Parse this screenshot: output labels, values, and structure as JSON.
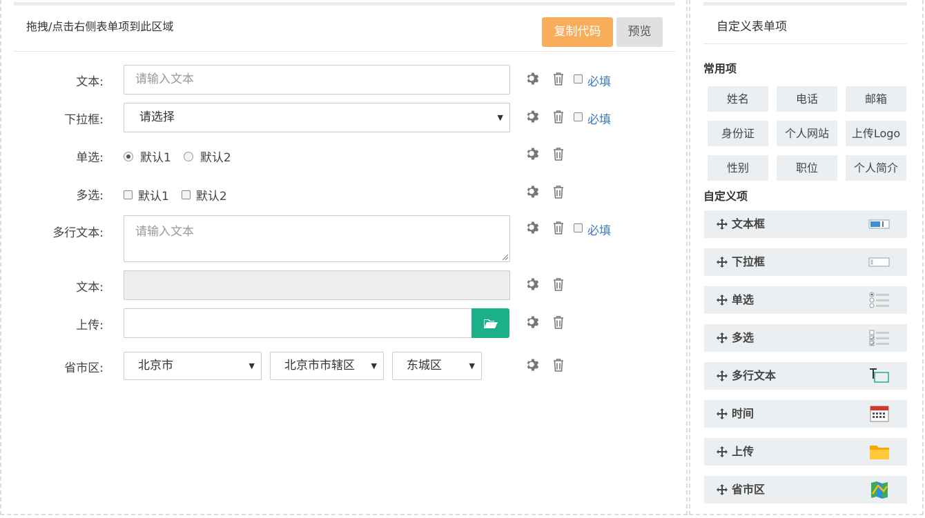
{
  "toolbar": {
    "drop_hint": "拖拽/点击右侧表单项到此区域",
    "copy_label": "复制代码",
    "preview_label": "预览"
  },
  "form": {
    "required_label": "必填",
    "rows": {
      "text": {
        "label": "文本:",
        "placeholder": "请输入文本"
      },
      "select": {
        "label": "下拉框:",
        "value": "请选择"
      },
      "radio": {
        "label": "单选:",
        "options": [
          "默认1",
          "默认2"
        ],
        "checked": "默认1"
      },
      "checkbox": {
        "label": "多选:",
        "options": [
          "默认1",
          "默认2"
        ]
      },
      "textarea": {
        "label": "多行文本:",
        "placeholder": "请输入文本"
      },
      "text_disabled": {
        "label": "文本:"
      },
      "upload": {
        "label": "上传:"
      },
      "region": {
        "label": "省市区:",
        "province": "北京市",
        "city": "北京市市辖区",
        "district": "东城区"
      }
    }
  },
  "panel": {
    "title": "自定义表单项",
    "common_heading": "常用项",
    "common_items": [
      "姓名",
      "电话",
      "邮箱",
      "身份证",
      "个人网站",
      "上传Logo",
      "性别",
      "职位",
      "个人简介"
    ],
    "custom_heading": "自定义项",
    "custom_items": [
      {
        "label": "文本框",
        "icon": "textbox-icon"
      },
      {
        "label": "下拉框",
        "icon": "dropdown-icon"
      },
      {
        "label": "单选",
        "icon": "radio-list-icon"
      },
      {
        "label": "多选",
        "icon": "checkbox-list-icon"
      },
      {
        "label": "多行文本",
        "icon": "multiline-text-icon"
      },
      {
        "label": "时间",
        "icon": "calendar-icon"
      },
      {
        "label": "上传",
        "icon": "folder-icon"
      },
      {
        "label": "省市区",
        "icon": "map-icon"
      }
    ]
  },
  "colors": {
    "copy_button": "#f7ad59",
    "upload_button": "#1cb08a",
    "required_link": "#3a78b8"
  }
}
